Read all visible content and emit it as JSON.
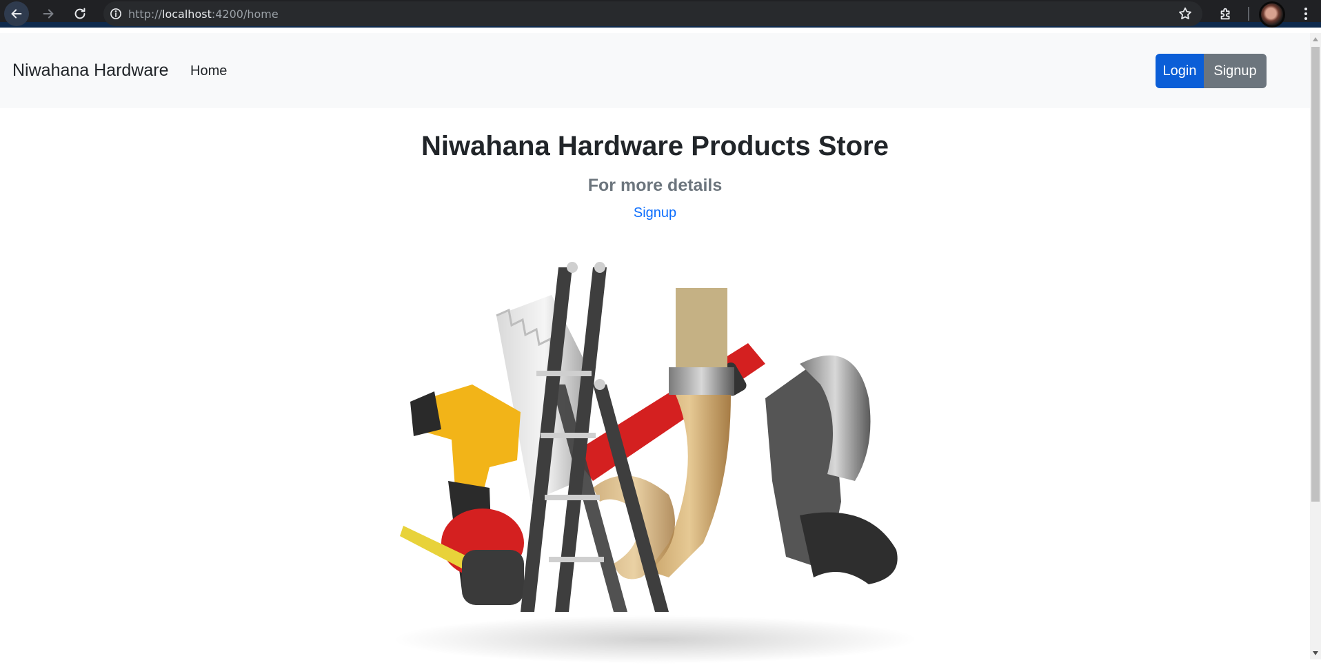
{
  "browser": {
    "url_scheme": "http://",
    "url_host": "localhost",
    "url_rest": ":4200/home",
    "colors": {
      "chrome_bg": "#202124",
      "omnibox_bg": "#282a2d",
      "accent_strip": "#0e2a4d"
    }
  },
  "navbar": {
    "brand": "Niwahana Hardware",
    "links": [
      {
        "label": "Home"
      }
    ],
    "login_label": "Login",
    "signup_label": "Signup",
    "colors": {
      "login": "#0b5ed7",
      "signup": "#6c757d",
      "navbar_bg": "#f8f9fa"
    }
  },
  "hero": {
    "title": "Niwahana Hardware Products Store",
    "subtitle": "For more details",
    "link_label": "Signup",
    "image": "hardware-tools-illustration"
  }
}
